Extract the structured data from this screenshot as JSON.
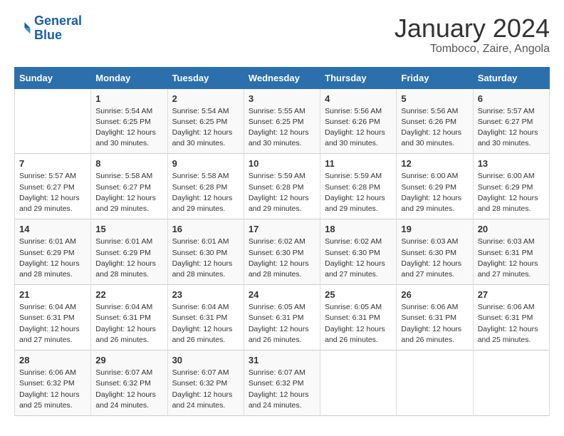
{
  "header": {
    "logo_line1": "General",
    "logo_line2": "Blue",
    "month_year": "January 2024",
    "location": "Tomboco, Zaire, Angola"
  },
  "days_of_week": [
    "Sunday",
    "Monday",
    "Tuesday",
    "Wednesday",
    "Thursday",
    "Friday",
    "Saturday"
  ],
  "weeks": [
    [
      {
        "day": "",
        "info": ""
      },
      {
        "day": "1",
        "info": "Sunrise: 5:54 AM\nSunset: 6:25 PM\nDaylight: 12 hours\nand 30 minutes."
      },
      {
        "day": "2",
        "info": "Sunrise: 5:54 AM\nSunset: 6:25 PM\nDaylight: 12 hours\nand 30 minutes."
      },
      {
        "day": "3",
        "info": "Sunrise: 5:55 AM\nSunset: 6:25 PM\nDaylight: 12 hours\nand 30 minutes."
      },
      {
        "day": "4",
        "info": "Sunrise: 5:56 AM\nSunset: 6:26 PM\nDaylight: 12 hours\nand 30 minutes."
      },
      {
        "day": "5",
        "info": "Sunrise: 5:56 AM\nSunset: 6:26 PM\nDaylight: 12 hours\nand 30 minutes."
      },
      {
        "day": "6",
        "info": "Sunrise: 5:57 AM\nSunset: 6:27 PM\nDaylight: 12 hours\nand 30 minutes."
      }
    ],
    [
      {
        "day": "7",
        "info": "Sunrise: 5:57 AM\nSunset: 6:27 PM\nDaylight: 12 hours\nand 29 minutes."
      },
      {
        "day": "8",
        "info": "Sunrise: 5:58 AM\nSunset: 6:27 PM\nDaylight: 12 hours\nand 29 minutes."
      },
      {
        "day": "9",
        "info": "Sunrise: 5:58 AM\nSunset: 6:28 PM\nDaylight: 12 hours\nand 29 minutes."
      },
      {
        "day": "10",
        "info": "Sunrise: 5:59 AM\nSunset: 6:28 PM\nDaylight: 12 hours\nand 29 minutes."
      },
      {
        "day": "11",
        "info": "Sunrise: 5:59 AM\nSunset: 6:28 PM\nDaylight: 12 hours\nand 29 minutes."
      },
      {
        "day": "12",
        "info": "Sunrise: 6:00 AM\nSunset: 6:29 PM\nDaylight: 12 hours\nand 29 minutes."
      },
      {
        "day": "13",
        "info": "Sunrise: 6:00 AM\nSunset: 6:29 PM\nDaylight: 12 hours\nand 28 minutes."
      }
    ],
    [
      {
        "day": "14",
        "info": "Sunrise: 6:01 AM\nSunset: 6:29 PM\nDaylight: 12 hours\nand 28 minutes."
      },
      {
        "day": "15",
        "info": "Sunrise: 6:01 AM\nSunset: 6:29 PM\nDaylight: 12 hours\nand 28 minutes."
      },
      {
        "day": "16",
        "info": "Sunrise: 6:01 AM\nSunset: 6:30 PM\nDaylight: 12 hours\nand 28 minutes."
      },
      {
        "day": "17",
        "info": "Sunrise: 6:02 AM\nSunset: 6:30 PM\nDaylight: 12 hours\nand 28 minutes."
      },
      {
        "day": "18",
        "info": "Sunrise: 6:02 AM\nSunset: 6:30 PM\nDaylight: 12 hours\nand 27 minutes."
      },
      {
        "day": "19",
        "info": "Sunrise: 6:03 AM\nSunset: 6:30 PM\nDaylight: 12 hours\nand 27 minutes."
      },
      {
        "day": "20",
        "info": "Sunrise: 6:03 AM\nSunset: 6:31 PM\nDaylight: 12 hours\nand 27 minutes."
      }
    ],
    [
      {
        "day": "21",
        "info": "Sunrise: 6:04 AM\nSunset: 6:31 PM\nDaylight: 12 hours\nand 27 minutes."
      },
      {
        "day": "22",
        "info": "Sunrise: 6:04 AM\nSunset: 6:31 PM\nDaylight: 12 hours\nand 26 minutes."
      },
      {
        "day": "23",
        "info": "Sunrise: 6:04 AM\nSunset: 6:31 PM\nDaylight: 12 hours\nand 26 minutes."
      },
      {
        "day": "24",
        "info": "Sunrise: 6:05 AM\nSunset: 6:31 PM\nDaylight: 12 hours\nand 26 minutes."
      },
      {
        "day": "25",
        "info": "Sunrise: 6:05 AM\nSunset: 6:31 PM\nDaylight: 12 hours\nand 26 minutes."
      },
      {
        "day": "26",
        "info": "Sunrise: 6:06 AM\nSunset: 6:31 PM\nDaylight: 12 hours\nand 26 minutes."
      },
      {
        "day": "27",
        "info": "Sunrise: 6:06 AM\nSunset: 6:31 PM\nDaylight: 12 hours\nand 25 minutes."
      }
    ],
    [
      {
        "day": "28",
        "info": "Sunrise: 6:06 AM\nSunset: 6:32 PM\nDaylight: 12 hours\nand 25 minutes."
      },
      {
        "day": "29",
        "info": "Sunrise: 6:07 AM\nSunset: 6:32 PM\nDaylight: 12 hours\nand 24 minutes."
      },
      {
        "day": "30",
        "info": "Sunrise: 6:07 AM\nSunset: 6:32 PM\nDaylight: 12 hours\nand 24 minutes."
      },
      {
        "day": "31",
        "info": "Sunrise: 6:07 AM\nSunset: 6:32 PM\nDaylight: 12 hours\nand 24 minutes."
      },
      {
        "day": "",
        "info": ""
      },
      {
        "day": "",
        "info": ""
      },
      {
        "day": "",
        "info": ""
      }
    ]
  ]
}
